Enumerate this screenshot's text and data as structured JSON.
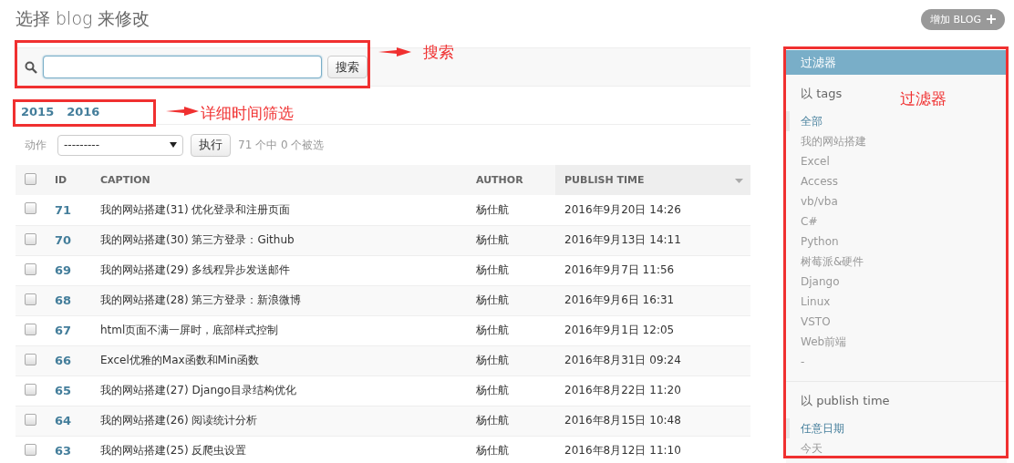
{
  "page_title": "选择 blog 来修改",
  "add_button": "增加 BLOG",
  "search": {
    "button": "搜索"
  },
  "date_hierarchy": [
    {
      "label": "2015"
    },
    {
      "label": "2016"
    }
  ],
  "actions": {
    "label": "动作",
    "select_value": "---------",
    "go_button": "执行",
    "counter": "71 个中 0 个被选"
  },
  "table": {
    "select_all_checked": false,
    "columns": [
      {
        "label": "ID",
        "sorted": false
      },
      {
        "label": "CAPTION",
        "sorted": false
      },
      {
        "label": "AUTHOR",
        "sorted": false
      },
      {
        "label": "PUBLISH TIME",
        "sorted": true
      }
    ],
    "rows": [
      {
        "id": "71",
        "caption": "我的网站搭建(31) 优化登录和注册页面",
        "author": "杨仕航",
        "publish_time": "2016年9月20日 14:26",
        "selected": false
      },
      {
        "id": "70",
        "caption": "我的网站搭建(30) 第三方登录：Github",
        "author": "杨仕航",
        "publish_time": "2016年9月13日 14:11",
        "selected": false
      },
      {
        "id": "69",
        "caption": "我的网站搭建(29) 多线程异步发送邮件",
        "author": "杨仕航",
        "publish_time": "2016年9月7日 11:56",
        "selected": false
      },
      {
        "id": "68",
        "caption": "我的网站搭建(28) 第三方登录：新浪微博",
        "author": "杨仕航",
        "publish_time": "2016年9月6日 16:31",
        "selected": false
      },
      {
        "id": "67",
        "caption": "html页面不满一屏时，底部样式控制",
        "author": "杨仕航",
        "publish_time": "2016年9月1日 12:05",
        "selected": false
      },
      {
        "id": "66",
        "caption": "Excel优雅的Max函数和Min函数",
        "author": "杨仕航",
        "publish_time": "2016年8月31日 09:24",
        "selected": false
      },
      {
        "id": "65",
        "caption": "我的网站搭建(27) Django目录结构优化",
        "author": "杨仕航",
        "publish_time": "2016年8月22日 11:20",
        "selected": false
      },
      {
        "id": "64",
        "caption": "我的网站搭建(26) 阅读统计分析",
        "author": "杨仕航",
        "publish_time": "2016年8月15日 10:48",
        "selected": false
      },
      {
        "id": "63",
        "caption": "我的网站搭建(25) 反爬虫设置",
        "author": "杨仕航",
        "publish_time": "2016年8月12日 11:10",
        "selected": false
      }
    ]
  },
  "filter": {
    "title": "过滤器",
    "groups": [
      {
        "heading": "以 tags",
        "items": [
          {
            "label": "全部",
            "selected": true
          },
          {
            "label": "我的网站搭建",
            "selected": false
          },
          {
            "label": "Excel",
            "selected": false
          },
          {
            "label": "Access",
            "selected": false
          },
          {
            "label": "vb/vba",
            "selected": false
          },
          {
            "label": "C#",
            "selected": false
          },
          {
            "label": "Python",
            "selected": false
          },
          {
            "label": "树莓派&硬件",
            "selected": false
          },
          {
            "label": "Django",
            "selected": false
          },
          {
            "label": "Linux",
            "selected": false
          },
          {
            "label": "VSTO",
            "selected": false
          },
          {
            "label": "Web前端",
            "selected": false
          },
          {
            "label": "-",
            "selected": false
          }
        ]
      },
      {
        "heading": "以 publish time",
        "items": [
          {
            "label": "任意日期",
            "selected": true
          },
          {
            "label": "今天",
            "selected": false
          }
        ]
      }
    ]
  },
  "annotations": [
    {
      "kind": "search",
      "text": "搜索"
    },
    {
      "kind": "date",
      "text": "详细时间筛选"
    },
    {
      "kind": "filter",
      "text": "过滤器"
    }
  ]
}
